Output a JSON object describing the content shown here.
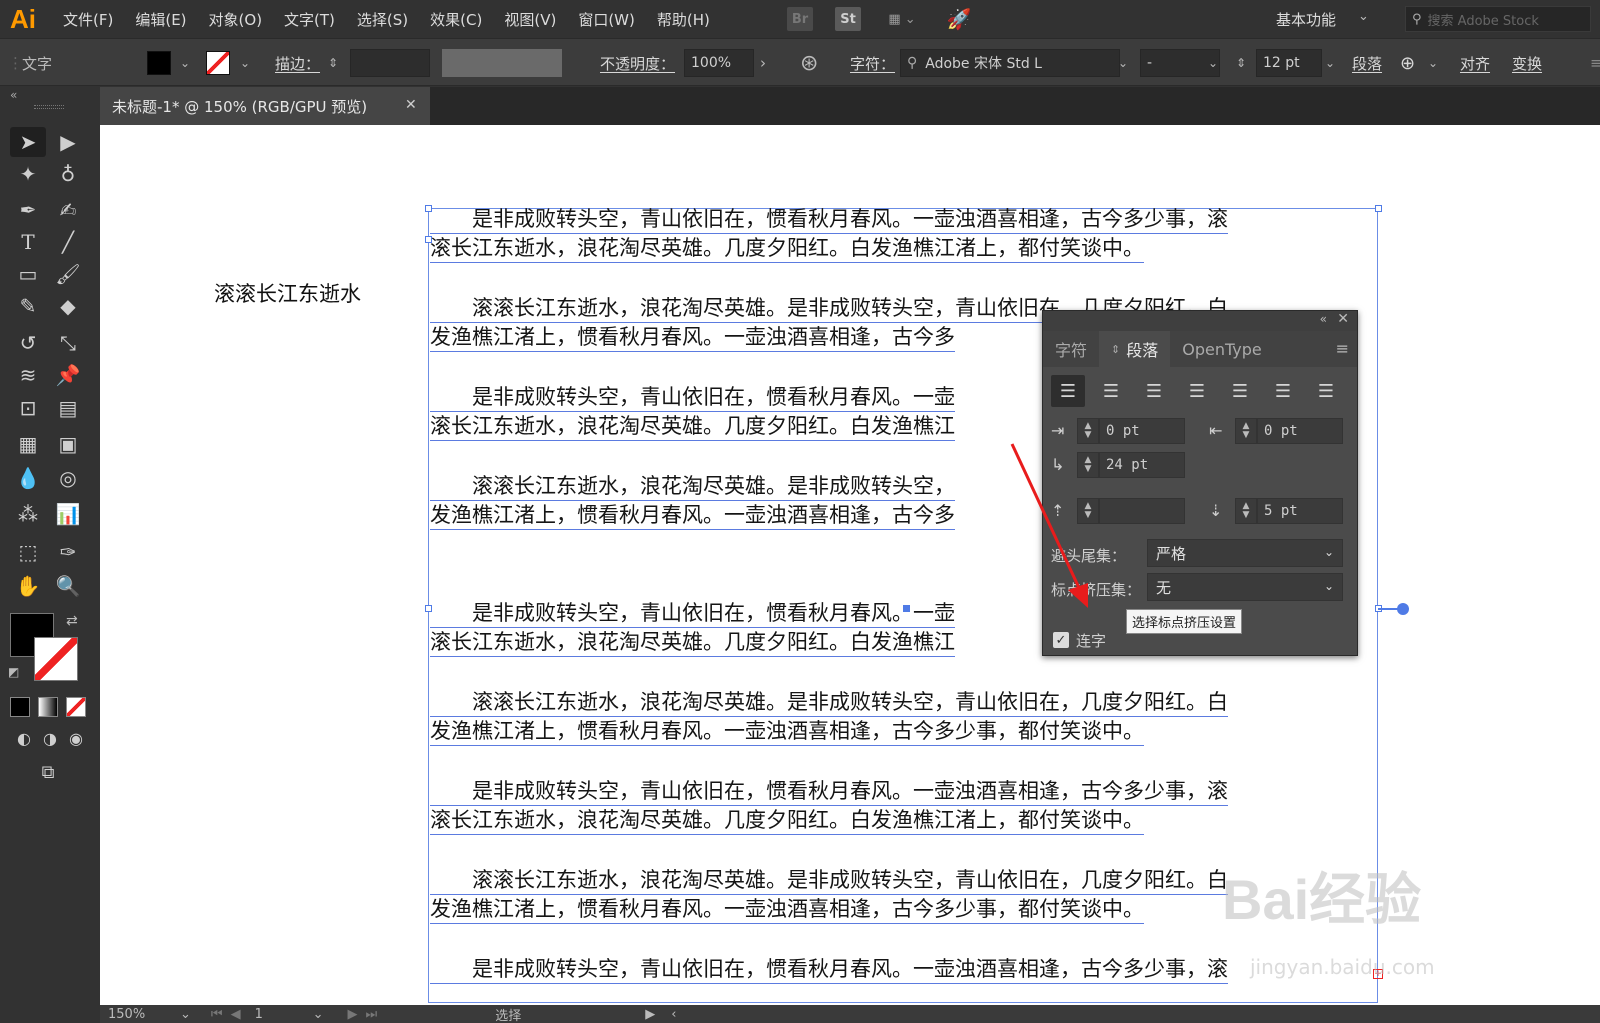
{
  "app": {
    "logo": "Ai"
  },
  "menu": [
    "文件(F)",
    "编辑(E)",
    "对象(O)",
    "文字(T)",
    "选择(S)",
    "效果(C)",
    "视图(V)",
    "窗口(W)",
    "帮助(H)"
  ],
  "bridge_label": "Br",
  "stock_label": "St",
  "workspace": "基本功能",
  "stock_search_placeholder": "搜索 Adobe Stock",
  "control": {
    "mode": "文字",
    "stroke_label": "描边：",
    "opacity_label": "不透明度：",
    "opacity_value": "100%",
    "char_label": "字符：",
    "font_name": "Adobe 宋体 Std L",
    "font_style": "-",
    "font_size": "12 pt",
    "para_label": "段落",
    "align_label": "对齐",
    "transform_label": "变换"
  },
  "tab": {
    "title": "未标题-1* @ 150% (RGB/GPU 预览)",
    "close": "✕"
  },
  "canvas": {
    "left_text": "滚滚长江东逝水",
    "paragraphs": [
      [
        "　　是非成败转头空，青山依旧在，惯看秋月春风。一壶浊酒喜相逢，古今多少事，滚",
        "滚长江东逝水，浪花淘尽英雄。几度夕阳红。白发渔樵江渚上，都付笑谈中。"
      ],
      [
        "　　滚滚长江东逝水，浪花淘尽英雄。是非成败转头空，青山依旧在，几度夕阳红。白",
        "发渔樵江渚上，惯看秋月春风。一壶浊酒喜相逢，古今多"
      ],
      [
        "　　是非成败转头空，青山依旧在，惯看秋月春风。一壶",
        "滚长江东逝水，浪花淘尽英雄。几度夕阳红。白发渔樵江"
      ],
      [
        "　　滚滚长江东逝水，浪花淘尽英雄。是非成败转头空，",
        "发渔樵江渚上，惯看秋月春风。一壶浊酒喜相逢，古今多"
      ],
      [
        "　　是非成败转头空，青山依旧在，惯看秋月春风。一壶",
        "滚长江东逝水，浪花淘尽英雄。几度夕阳红。白发渔樵江"
      ],
      [
        "　　滚滚长江东逝水，浪花淘尽英雄。是非成败转头空，青山依旧在，几度夕阳红。白",
        "发渔樵江渚上，惯看秋月春风。一壶浊酒喜相逢，古今多少事，都付笑谈中。"
      ],
      [
        "　　是非成败转头空，青山依旧在，惯看秋月春风。一壶浊酒喜相逢，古今多少事，滚",
        "滚长江东逝水，浪花淘尽英雄。几度夕阳红。白发渔樵江渚上，都付笑谈中。"
      ],
      [
        "　　滚滚长江东逝水，浪花淘尽英雄。是非成败转头空，青山依旧在，几度夕阳红。白",
        "发渔樵江渚上，惯看秋月春风。一壶浊酒喜相逢，古今多少事，都付笑谈中。"
      ],
      [
        "　　是非成败转头空，青山依旧在，惯看秋月春风。一壶浊酒喜相逢，古今多少事，滚"
      ]
    ]
  },
  "panel": {
    "tabs": [
      "字符",
      "段落",
      "OpenType"
    ],
    "left_indent": "0 pt",
    "right_indent": "0 pt",
    "first_line_indent": "24 pt",
    "space_before": "",
    "space_after": "5 pt",
    "kinsoku_label": "避头尾集：",
    "kinsoku_value": "严格",
    "mojikumi_label": "标点挤压集：",
    "mojikumi_value": "无",
    "hyphenate_label": "连字",
    "tooltip": "选择标点挤压设置"
  },
  "status": {
    "zoom": "150%",
    "artboard": "1",
    "mode": "选择"
  },
  "watermark": {
    "main": "Bai经验",
    "sub": "jingyan.baidu.com"
  },
  "colors": {
    "accent": "#ff9a00",
    "selection": "#4f7be6",
    "arrow": "#e81c1c"
  }
}
